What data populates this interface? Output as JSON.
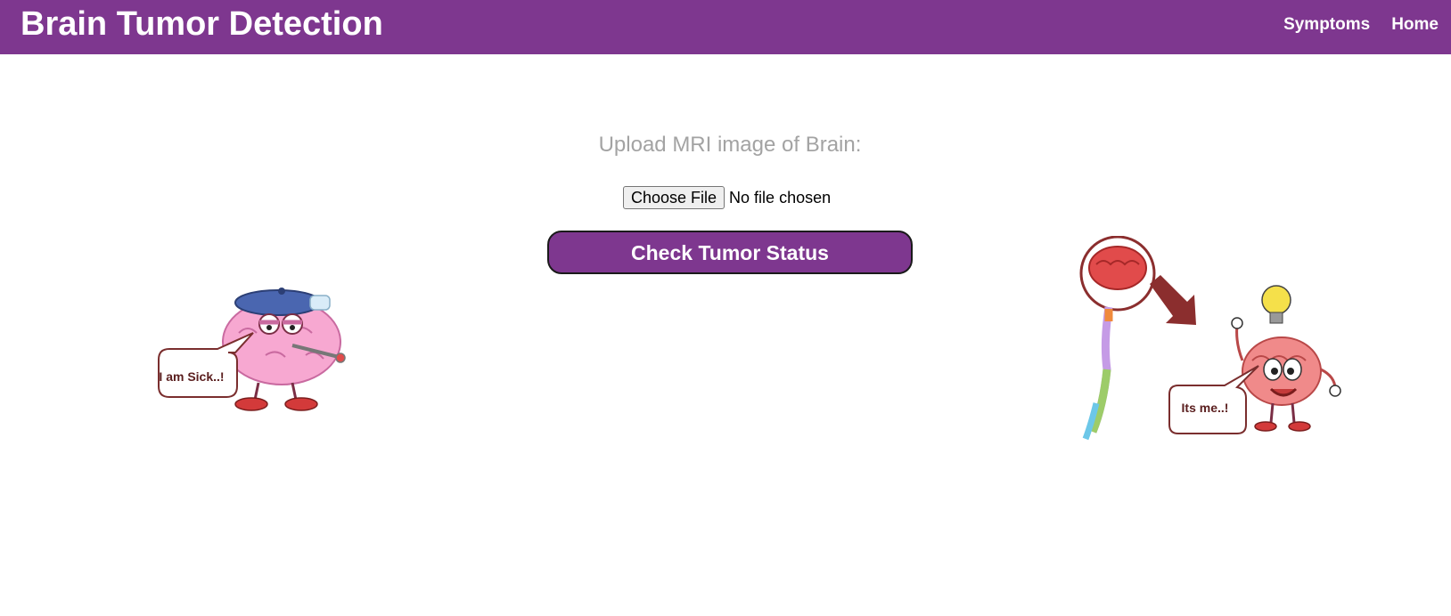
{
  "navbar": {
    "brand": "Brain Tumor Detection",
    "links": [
      "Symptoms",
      "Home"
    ]
  },
  "upload": {
    "label": "Upload MRI image of Brain:",
    "choose_file_label": "Choose File",
    "file_status": "No file chosen"
  },
  "actions": {
    "check_label": "Check Tumor Status"
  },
  "illustrations": {
    "left_bubble": "I am Sick..!",
    "right_bubble": "Its me..!"
  },
  "colors": {
    "brand": "#7e378f",
    "brain_pink": "#f7a8d1",
    "brain_red": "#e14b4b",
    "bubble_text": "#5a1e1e"
  }
}
